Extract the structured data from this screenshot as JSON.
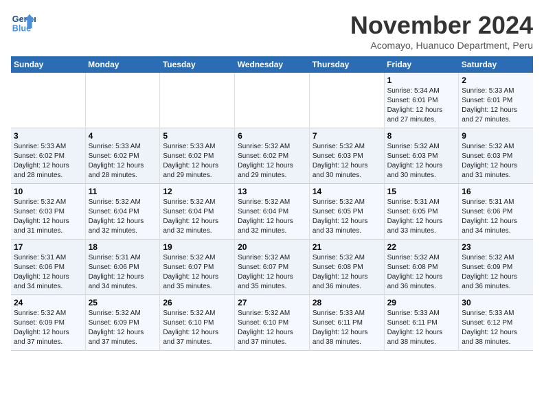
{
  "logo": {
    "line1": "General",
    "line2": "Blue"
  },
  "title": "November 2024",
  "subtitle": "Acomayo, Huanuco Department, Peru",
  "headers": [
    "Sunday",
    "Monday",
    "Tuesday",
    "Wednesday",
    "Thursday",
    "Friday",
    "Saturday"
  ],
  "weeks": [
    [
      {
        "day": "",
        "info": ""
      },
      {
        "day": "",
        "info": ""
      },
      {
        "day": "",
        "info": ""
      },
      {
        "day": "",
        "info": ""
      },
      {
        "day": "",
        "info": ""
      },
      {
        "day": "1",
        "info": "Sunrise: 5:34 AM\nSunset: 6:01 PM\nDaylight: 12 hours\nand 27 minutes."
      },
      {
        "day": "2",
        "info": "Sunrise: 5:33 AM\nSunset: 6:01 PM\nDaylight: 12 hours\nand 27 minutes."
      }
    ],
    [
      {
        "day": "3",
        "info": "Sunrise: 5:33 AM\nSunset: 6:02 PM\nDaylight: 12 hours\nand 28 minutes."
      },
      {
        "day": "4",
        "info": "Sunrise: 5:33 AM\nSunset: 6:02 PM\nDaylight: 12 hours\nand 28 minutes."
      },
      {
        "day": "5",
        "info": "Sunrise: 5:33 AM\nSunset: 6:02 PM\nDaylight: 12 hours\nand 29 minutes."
      },
      {
        "day": "6",
        "info": "Sunrise: 5:32 AM\nSunset: 6:02 PM\nDaylight: 12 hours\nand 29 minutes."
      },
      {
        "day": "7",
        "info": "Sunrise: 5:32 AM\nSunset: 6:03 PM\nDaylight: 12 hours\nand 30 minutes."
      },
      {
        "day": "8",
        "info": "Sunrise: 5:32 AM\nSunset: 6:03 PM\nDaylight: 12 hours\nand 30 minutes."
      },
      {
        "day": "9",
        "info": "Sunrise: 5:32 AM\nSunset: 6:03 PM\nDaylight: 12 hours\nand 31 minutes."
      }
    ],
    [
      {
        "day": "10",
        "info": "Sunrise: 5:32 AM\nSunset: 6:03 PM\nDaylight: 12 hours\nand 31 minutes."
      },
      {
        "day": "11",
        "info": "Sunrise: 5:32 AM\nSunset: 6:04 PM\nDaylight: 12 hours\nand 32 minutes."
      },
      {
        "day": "12",
        "info": "Sunrise: 5:32 AM\nSunset: 6:04 PM\nDaylight: 12 hours\nand 32 minutes."
      },
      {
        "day": "13",
        "info": "Sunrise: 5:32 AM\nSunset: 6:04 PM\nDaylight: 12 hours\nand 32 minutes."
      },
      {
        "day": "14",
        "info": "Sunrise: 5:32 AM\nSunset: 6:05 PM\nDaylight: 12 hours\nand 33 minutes."
      },
      {
        "day": "15",
        "info": "Sunrise: 5:31 AM\nSunset: 6:05 PM\nDaylight: 12 hours\nand 33 minutes."
      },
      {
        "day": "16",
        "info": "Sunrise: 5:31 AM\nSunset: 6:06 PM\nDaylight: 12 hours\nand 34 minutes."
      }
    ],
    [
      {
        "day": "17",
        "info": "Sunrise: 5:31 AM\nSunset: 6:06 PM\nDaylight: 12 hours\nand 34 minutes."
      },
      {
        "day": "18",
        "info": "Sunrise: 5:31 AM\nSunset: 6:06 PM\nDaylight: 12 hours\nand 34 minutes."
      },
      {
        "day": "19",
        "info": "Sunrise: 5:32 AM\nSunset: 6:07 PM\nDaylight: 12 hours\nand 35 minutes."
      },
      {
        "day": "20",
        "info": "Sunrise: 5:32 AM\nSunset: 6:07 PM\nDaylight: 12 hours\nand 35 minutes."
      },
      {
        "day": "21",
        "info": "Sunrise: 5:32 AM\nSunset: 6:08 PM\nDaylight: 12 hours\nand 36 minutes."
      },
      {
        "day": "22",
        "info": "Sunrise: 5:32 AM\nSunset: 6:08 PM\nDaylight: 12 hours\nand 36 minutes."
      },
      {
        "day": "23",
        "info": "Sunrise: 5:32 AM\nSunset: 6:09 PM\nDaylight: 12 hours\nand 36 minutes."
      }
    ],
    [
      {
        "day": "24",
        "info": "Sunrise: 5:32 AM\nSunset: 6:09 PM\nDaylight: 12 hours\nand 37 minutes."
      },
      {
        "day": "25",
        "info": "Sunrise: 5:32 AM\nSunset: 6:09 PM\nDaylight: 12 hours\nand 37 minutes."
      },
      {
        "day": "26",
        "info": "Sunrise: 5:32 AM\nSunset: 6:10 PM\nDaylight: 12 hours\nand 37 minutes."
      },
      {
        "day": "27",
        "info": "Sunrise: 5:32 AM\nSunset: 6:10 PM\nDaylight: 12 hours\nand 37 minutes."
      },
      {
        "day": "28",
        "info": "Sunrise: 5:33 AM\nSunset: 6:11 PM\nDaylight: 12 hours\nand 38 minutes."
      },
      {
        "day": "29",
        "info": "Sunrise: 5:33 AM\nSunset: 6:11 PM\nDaylight: 12 hours\nand 38 minutes."
      },
      {
        "day": "30",
        "info": "Sunrise: 5:33 AM\nSunset: 6:12 PM\nDaylight: 12 hours\nand 38 minutes."
      }
    ]
  ]
}
